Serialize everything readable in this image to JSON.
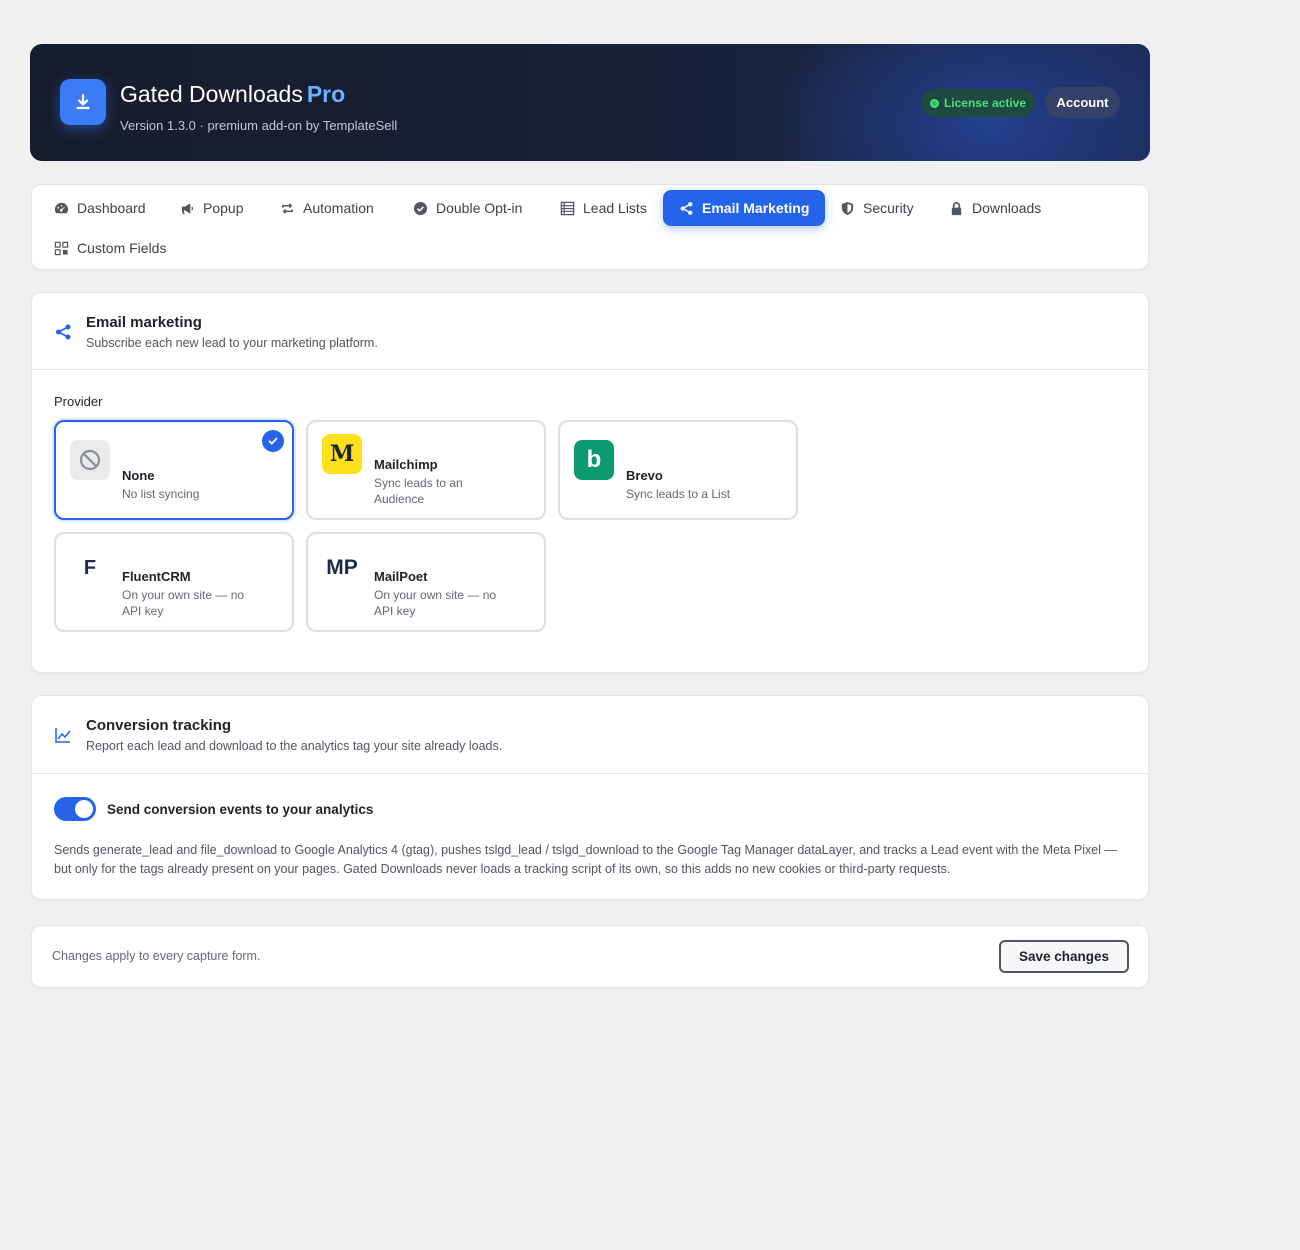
{
  "header": {
    "title": "Gated Downloads",
    "title_highlight": "Pro",
    "subtitle": "Version 1.3.0 · premium add-on by TemplateSell",
    "license_label": "License active",
    "account_label": "Account",
    "logo_icon": "download-icon"
  },
  "tabs": [
    {
      "label": "Dashboard",
      "icon": "gauge-icon"
    },
    {
      "label": "Popup",
      "icon": "megaphone-icon"
    },
    {
      "label": "Automation",
      "icon": "repeat-icon"
    },
    {
      "label": "Double Opt-in",
      "icon": "check-circle-icon"
    },
    {
      "label": "Lead Lists",
      "icon": "list-icon"
    },
    {
      "label": "Email Marketing",
      "icon": "share-icon",
      "active": true
    },
    {
      "label": "Security",
      "icon": "shield-icon"
    },
    {
      "label": "Downloads",
      "icon": "lock-icon"
    },
    {
      "label": "Custom Fields",
      "icon": "grid-icon"
    }
  ],
  "email_marketing": {
    "title": "Email marketing",
    "description": "Subscribe each new lead to your marketing platform.",
    "provider_label": "Provider",
    "providers": [
      {
        "name": "None",
        "description": "No list syncing",
        "logo": "",
        "selected": true
      },
      {
        "name": "Mailchimp",
        "description": "Sync leads to an Audience",
        "logo": "M"
      },
      {
        "name": "Brevo",
        "description": "Sync leads to a List",
        "logo": "b"
      },
      {
        "name": "FluentCRM",
        "description": "On your own site — no API key",
        "logo": "F"
      },
      {
        "name": "MailPoet",
        "description": "On your own site — no API key",
        "logo": "MP"
      }
    ]
  },
  "conversion_tracking": {
    "title": "Conversion tracking",
    "description": "Report each lead and download to the analytics tag your site already loads.",
    "toggle_label": "Send conversion events to your analytics",
    "toggle_on": true,
    "details": "Sends generate_lead and file_download to Google Analytics 4 (gtag), pushes tslgd_lead / tslgd_download to the Google Tag Manager dataLayer, and tracks a Lead event with the Meta Pixel — but only for the tags already present on your pages. Gated Downloads never loads a tracking script of its own, so this adds no new cookies or third-party requests."
  },
  "footer": {
    "note": "Changes apply to every capture form.",
    "save_label": "Save changes"
  },
  "colors": {
    "accent": "#2563eb",
    "header_bg": "#151c2c",
    "license_green": "#4ade80",
    "mailchimp_yellow": "#ffe01b",
    "brevo_green": "#0b996e"
  }
}
